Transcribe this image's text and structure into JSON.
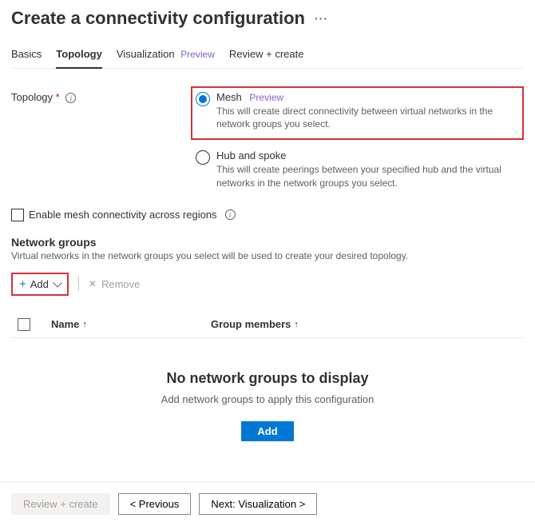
{
  "header": {
    "title": "Create a connectivity configuration"
  },
  "tabs": {
    "basics": "Basics",
    "topology": "Topology",
    "visualization": "Visualization",
    "visualization_badge": "Preview",
    "review": "Review + create"
  },
  "topology_form": {
    "label": "Topology",
    "mesh": {
      "title": "Mesh",
      "badge": "Preview",
      "desc": "This will create direct connectivity between virtual networks in the network groups you select."
    },
    "hubspoke": {
      "title": "Hub and spoke",
      "desc": "This will create peerings between your specified hub and the virtual networks in the network groups you select."
    }
  },
  "mesh_checkbox": {
    "label": "Enable mesh connectivity across regions"
  },
  "network_groups": {
    "title": "Network groups",
    "desc": "Virtual networks in the network groups you select will be used to create your desired topology.",
    "add_label": "Add",
    "remove_label": "Remove",
    "columns": {
      "name": "Name",
      "members": "Group members"
    },
    "empty": {
      "title": "No network groups to display",
      "desc": "Add network groups to apply this configuration",
      "button": "Add"
    }
  },
  "footer": {
    "review": "Review + create",
    "previous": "< Previous",
    "next": "Next: Visualization >"
  }
}
